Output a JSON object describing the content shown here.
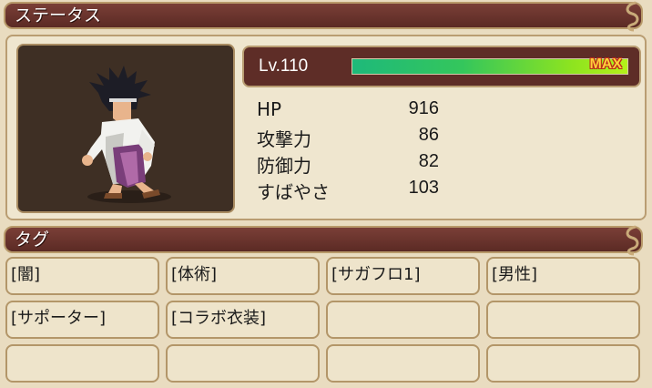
{
  "status_section": {
    "title": "ステータス"
  },
  "level": {
    "label": "Lv.110",
    "progress_fraction": 1.0,
    "max_label": "MAX"
  },
  "stats": [
    {
      "label": "HP",
      "value": "916"
    },
    {
      "label": "攻撃力",
      "value": "86"
    },
    {
      "label": "防御力",
      "value": "82"
    },
    {
      "label": "すばやさ",
      "value": "103"
    }
  ],
  "tags_section": {
    "title": "タグ"
  },
  "tags": [
    "[闇]",
    "[体術]",
    "[サガフロ1]",
    "[男性]",
    "[サポーター]",
    "[コラボ衣装]",
    "",
    "",
    "",
    "",
    "",
    ""
  ],
  "icons": {
    "header_curl": "ornament-curl-icon",
    "portrait": "character-sprite"
  },
  "colors": {
    "header_bg": "#6b332c",
    "panel_bg": "#efe6cf",
    "portrait_bg": "#3e2f24",
    "gauge_start": "#1eb97a",
    "gauge_end": "#b4f01a",
    "max_text": "#ffcf3a"
  }
}
